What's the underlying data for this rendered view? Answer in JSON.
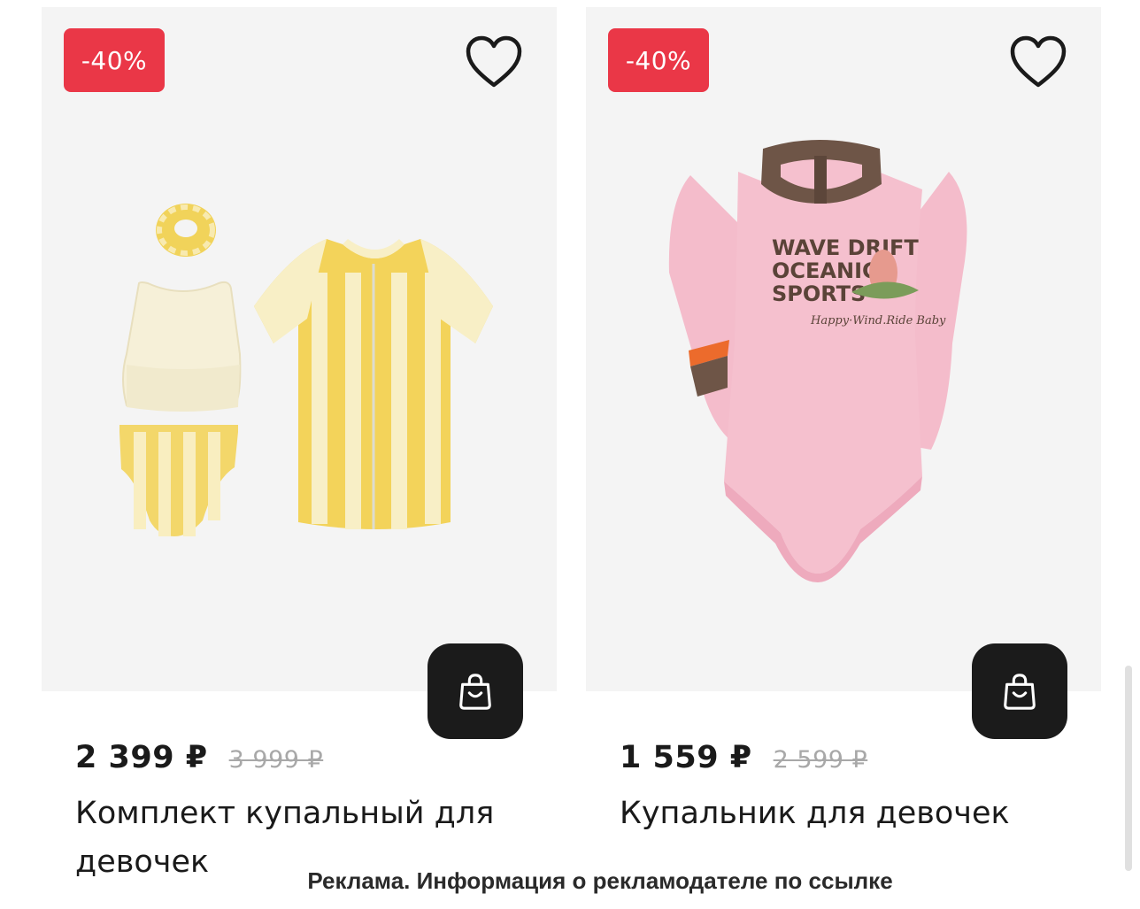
{
  "products": [
    {
      "discount_badge": "-40%",
      "price": "2 399 ₽",
      "old_price": "3 999 ₽",
      "title": "Комплект купальный для девочек",
      "image_icon": "yellow-striped-swim-set"
    },
    {
      "discount_badge": "-40%",
      "price": "1 559 ₽",
      "old_price": "2 599 ₽",
      "title": "Купальник для девочек",
      "image_icon": "pink-long-sleeve-swimsuit",
      "print_text": [
        "WAVE DRIFT",
        "OCEANIC",
        "SPORTS",
        "Happy·Wind.Ride Baby"
      ]
    }
  ],
  "ad_notice": "Реклама. Информация о рекламодателе по ссылке",
  "colors": {
    "badge": "#ea3747",
    "cart_button": "#1b1b1b",
    "image_bg": "#f4f4f4",
    "old_price": "#a8a8a8"
  }
}
